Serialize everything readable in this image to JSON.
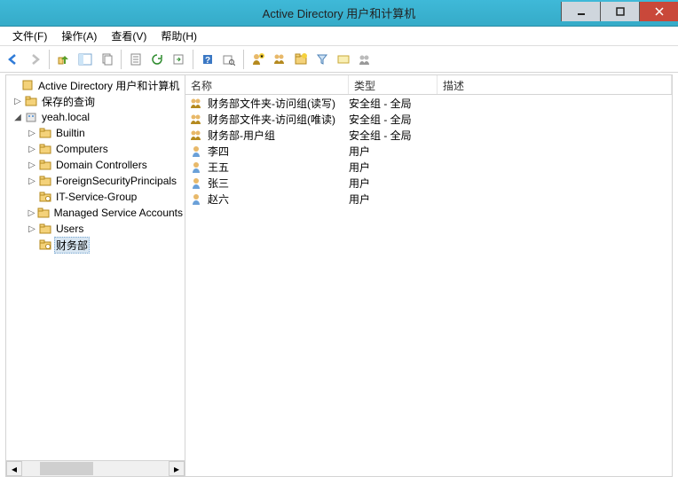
{
  "window": {
    "title": "Active Directory 用户和计算机"
  },
  "menu": {
    "file": "文件(F)",
    "action": "操作(A)",
    "view": "查看(V)",
    "help": "帮助(H)"
  },
  "tree": {
    "root": "Active Directory 用户和计算机",
    "saved_queries": "保存的查询",
    "domain": "yeah.local",
    "children": [
      "Builtin",
      "Computers",
      "Domain Controllers",
      "ForeignSecurityPrincipals",
      "IT-Service-Group",
      "Managed Service Accounts",
      "Users",
      "财务部"
    ]
  },
  "list": {
    "headers": {
      "name": "名称",
      "type": "类型",
      "desc": "描述"
    },
    "rows": [
      {
        "icon": "group",
        "name": "财务部文件夹-访问组(读写)",
        "type": "安全组 - 全局"
      },
      {
        "icon": "group",
        "name": "财务部文件夹-访问组(唯读)",
        "type": "安全组 - 全局"
      },
      {
        "icon": "group",
        "name": "财务部-用户组",
        "type": "安全组 - 全局"
      },
      {
        "icon": "user",
        "name": "李四",
        "type": "用户"
      },
      {
        "icon": "user",
        "name": "王五",
        "type": "用户"
      },
      {
        "icon": "user",
        "name": "张三",
        "type": "用户"
      },
      {
        "icon": "user",
        "name": "赵六",
        "type": "用户"
      }
    ]
  }
}
